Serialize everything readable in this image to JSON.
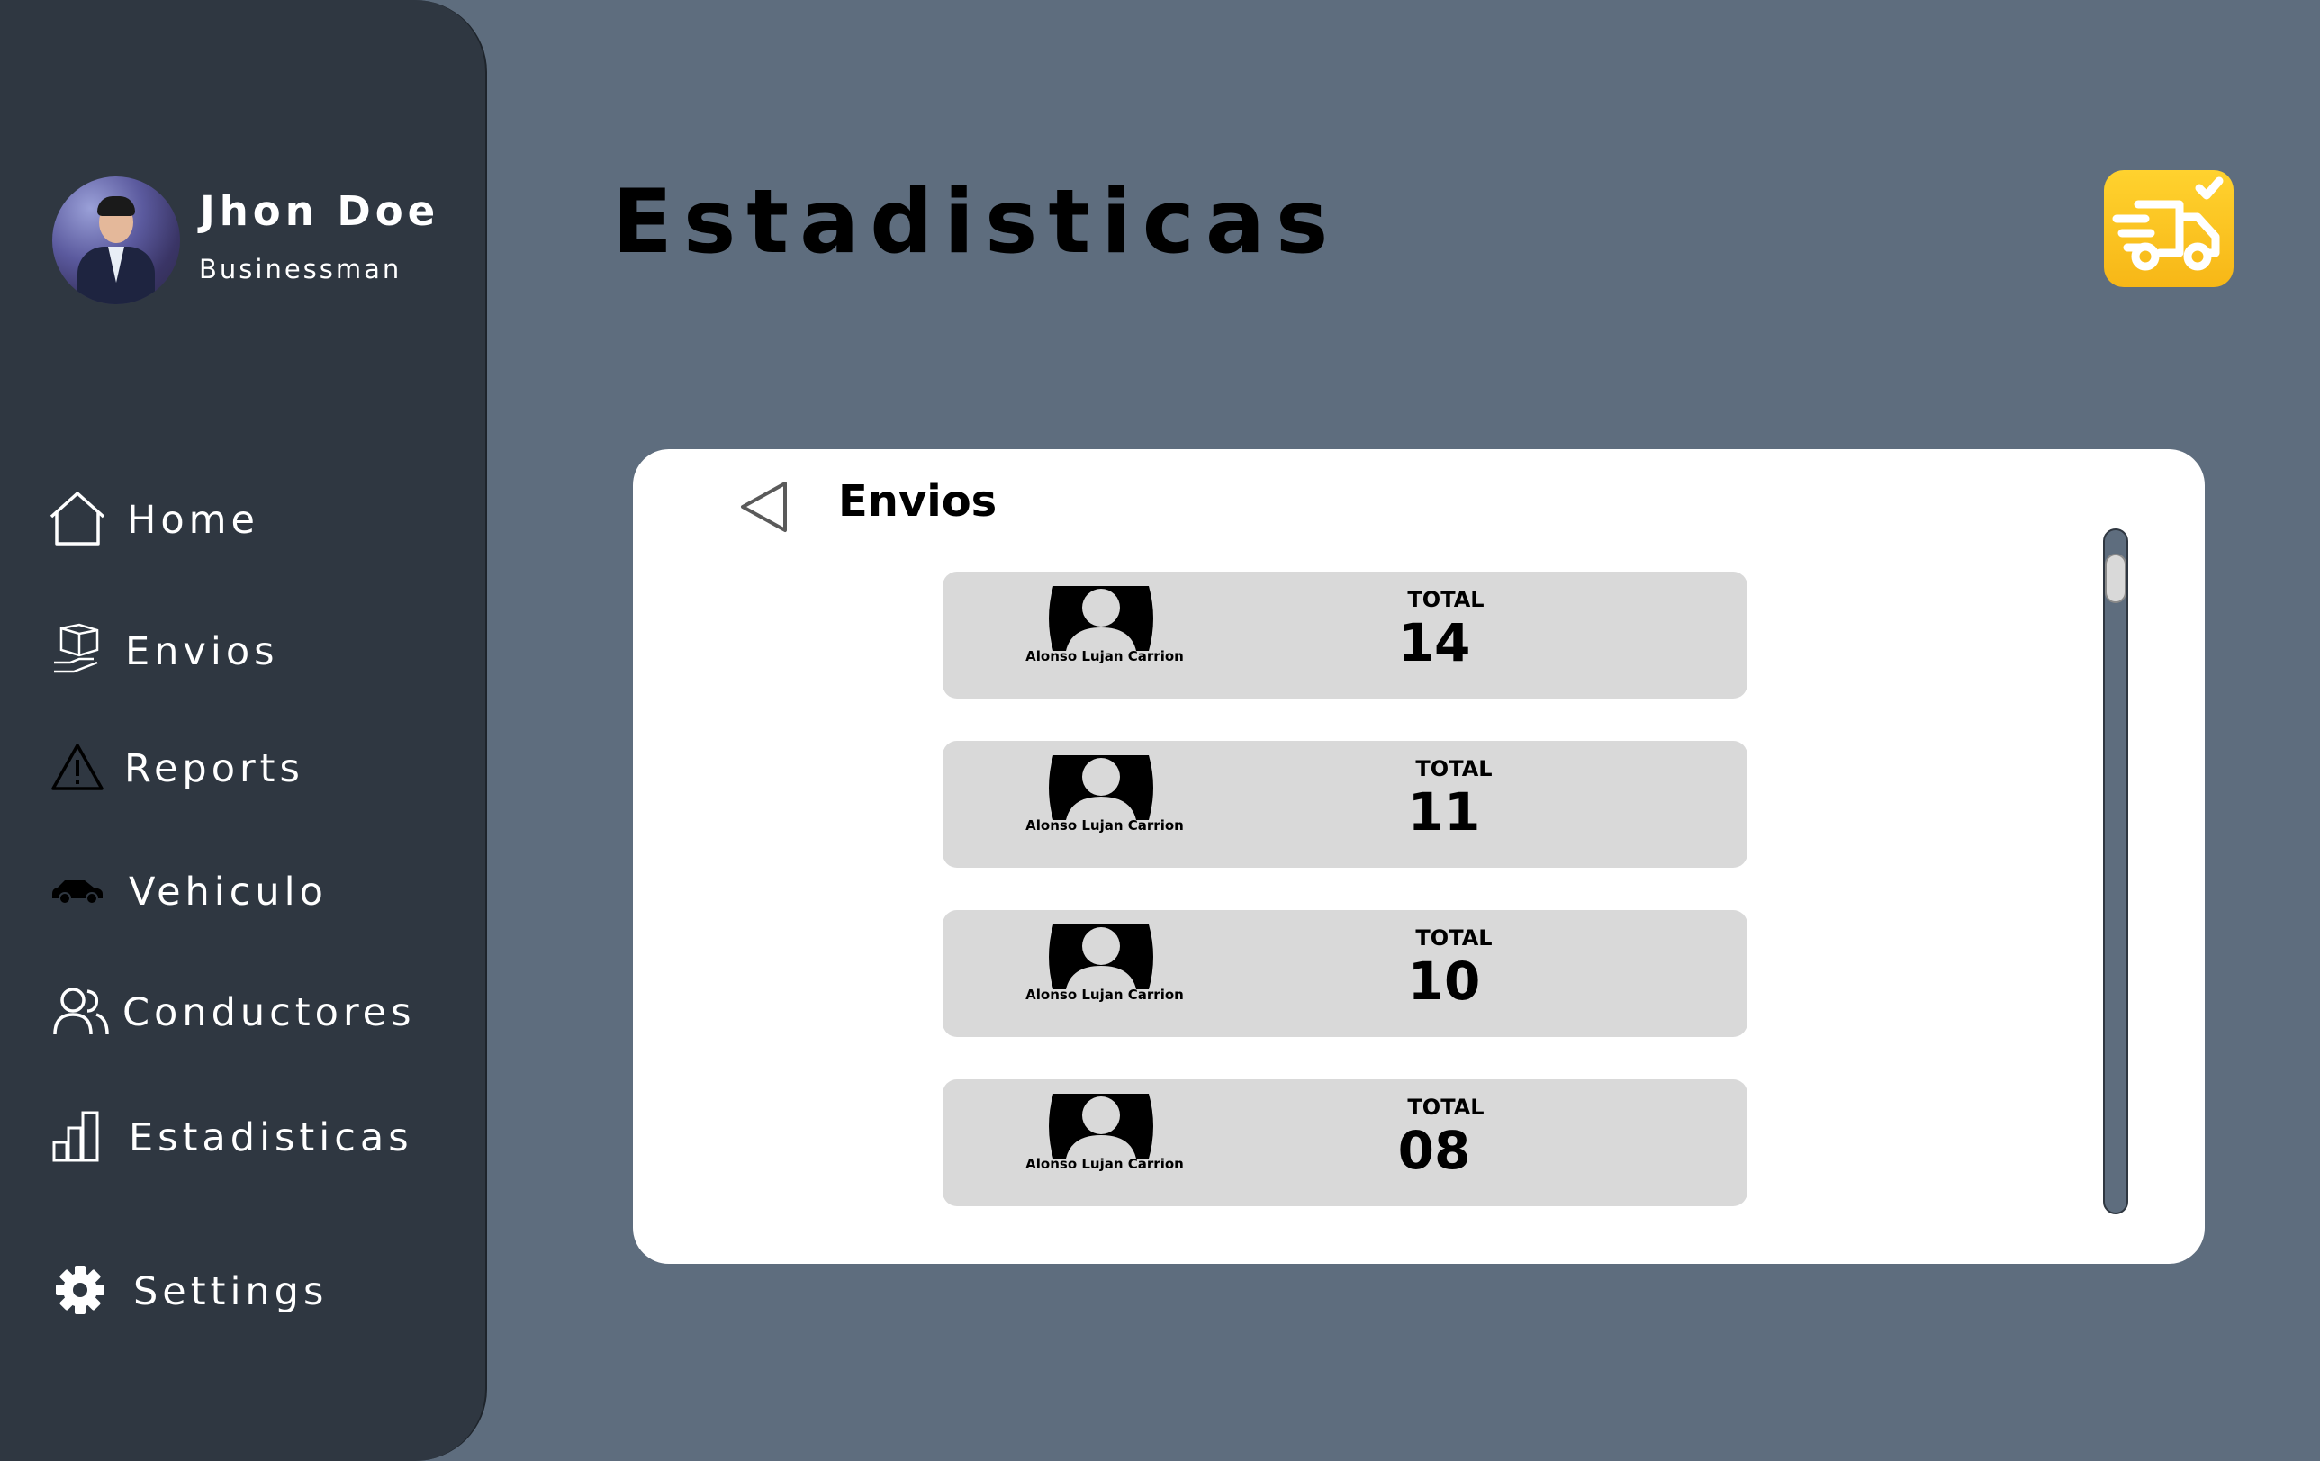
{
  "user": {
    "name": "Jhon Doe",
    "role": "Businessman"
  },
  "nav": [
    {
      "label": "Home",
      "icon": "home-icon"
    },
    {
      "label": "Envios",
      "icon": "package-icon"
    },
    {
      "label": "Reports",
      "icon": "warning-icon"
    },
    {
      "label": "Vehiculo",
      "icon": "car-icon"
    },
    {
      "label": "Conductores",
      "icon": "users-icon"
    },
    {
      "label": "Estadisticas",
      "icon": "bar-chart-icon"
    },
    {
      "label": "Settings",
      "icon": "gear-icon"
    }
  ],
  "header": {
    "title": "Estadisticas",
    "logo_icon": "delivery-truck-icon"
  },
  "panel": {
    "title": "Envios",
    "back_icon": "back-arrow-icon",
    "cards": [
      {
        "driver": "Alonso Lujan Carrion",
        "total_label": "TOTAL",
        "total": "14"
      },
      {
        "driver": "Alonso Lujan Carrion",
        "total_label": "TOTAL",
        "total": "11"
      },
      {
        "driver": "Alonso Lujan Carrion",
        "total_label": "TOTAL",
        "total": "10"
      },
      {
        "driver": "Alonso Lujan Carrion",
        "total_label": "TOTAL",
        "total": "08"
      }
    ]
  },
  "colors": {
    "background": "#5e6d7e",
    "sidebar": "#2f3741",
    "panel": "#ffffff",
    "card": "#d9d9d9",
    "accent": "#ffc61e"
  }
}
